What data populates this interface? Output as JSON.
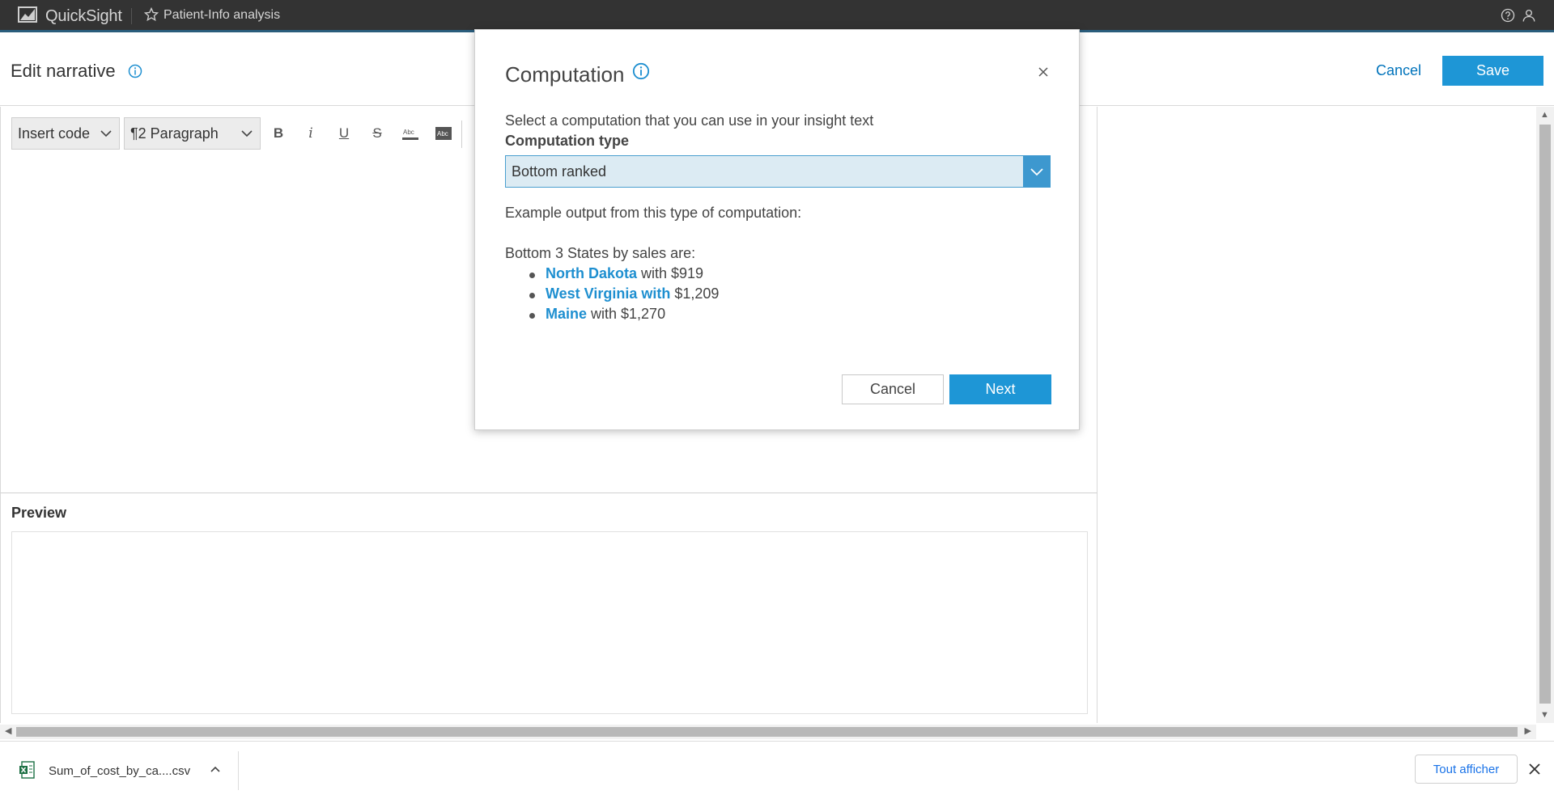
{
  "topbar": {
    "brand": "QuickSight",
    "analysis_title": "Patient-Info analysis"
  },
  "header": {
    "title": "Edit narrative",
    "cancel_label": "Cancel",
    "save_label": "Save"
  },
  "toolbar": {
    "insert_code_label": "Insert code",
    "paragraph_label": "¶2 Paragraph",
    "bold": "B",
    "italic": "i",
    "underline": "U",
    "strikethrough": "S"
  },
  "preview": {
    "title": "Preview"
  },
  "modal": {
    "title": "Computation",
    "description": "Select a computation that you can use in your insight text",
    "type_label": "Computation type",
    "selected_type": "Bottom ranked",
    "example_label": "Example output from this type of computation:",
    "example_heading": "Bottom 3 States by sales are:",
    "example_items": [
      {
        "name": "North Dakota",
        "rest": " with $919"
      },
      {
        "name": "West Virginia with",
        "rest": " $1,209"
      },
      {
        "name": "Maine",
        "rest": " with $1,270"
      }
    ],
    "cancel_label": "Cancel",
    "next_label": "Next"
  },
  "download_bar": {
    "filename": "Sum_of_cost_by_ca....csv",
    "show_all_label": "Tout afficher"
  },
  "colors": {
    "accent": "#1e96d6",
    "topbar_bg": "#333333",
    "link": "#1e8fd0"
  }
}
